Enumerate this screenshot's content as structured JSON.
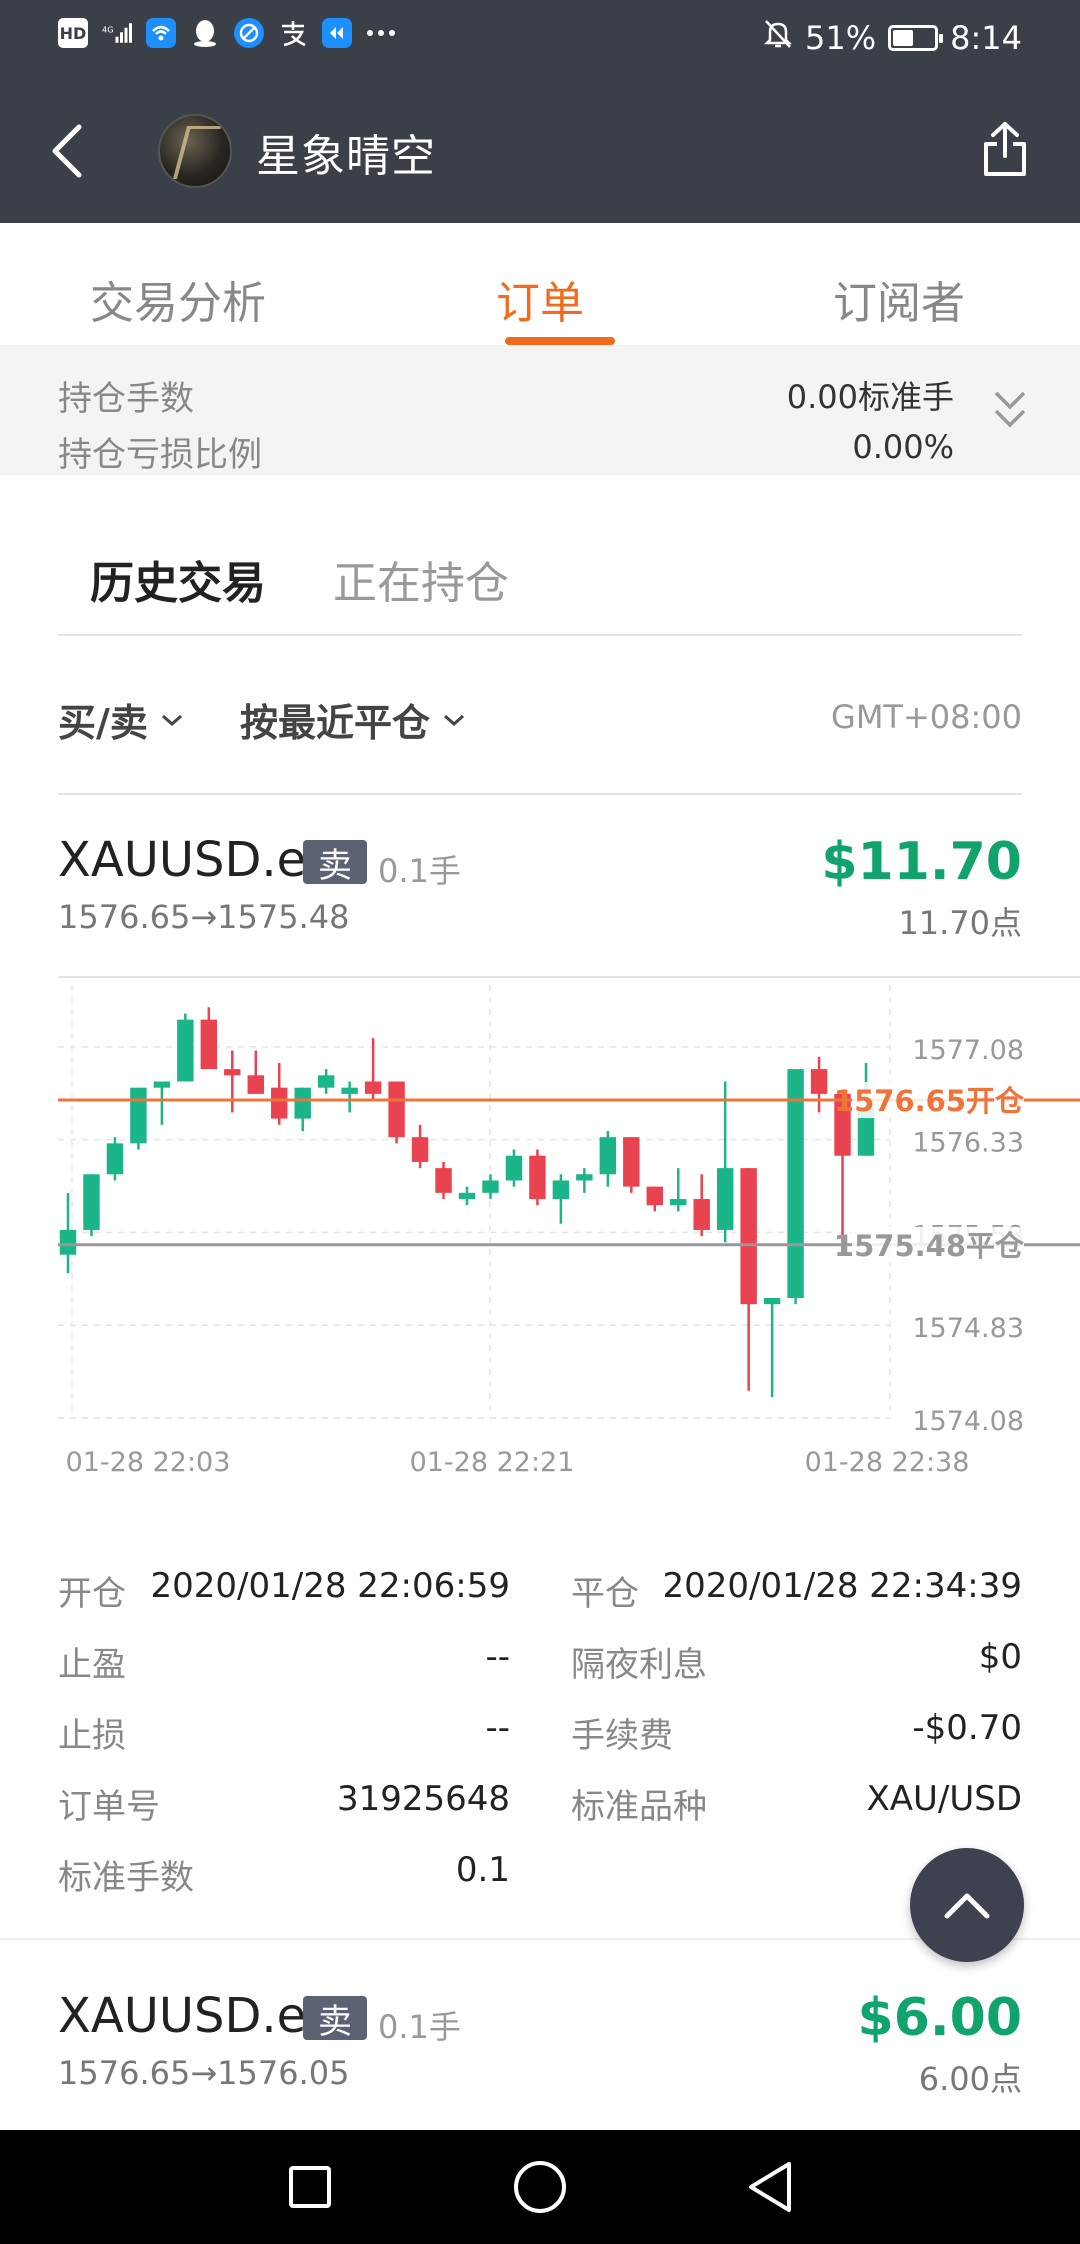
{
  "status_bar": {
    "left_icons": [
      "hd-icon",
      "signal-4g-icon",
      "wifi-icon",
      "qq-icon",
      "browser-icon",
      "alipay-icon",
      "app-icon",
      "more-dots-icon"
    ],
    "battery_level": 0.51,
    "battery_text": "51%",
    "time": "8:14"
  },
  "header": {
    "title": "星象晴空"
  },
  "tabs": [
    {
      "label": "交易分析",
      "active": false
    },
    {
      "label": "订单",
      "active": true
    },
    {
      "label": "订阅者",
      "active": false
    }
  ],
  "summary": {
    "rows": [
      {
        "label": "持仓手数",
        "value": "0.00标准手"
      },
      {
        "label": "持仓亏损比例",
        "value": "0.00%"
      }
    ]
  },
  "subtabs": [
    {
      "label": "历史交易",
      "active": true
    },
    {
      "label": "正在持仓",
      "active": false
    }
  ],
  "filters": {
    "side": "买/卖",
    "sort": "按最近平仓",
    "timezone": "GMT+08:00"
  },
  "orders": [
    {
      "symbol": "XAUUSD.e",
      "side": "卖",
      "lots": "0.1手",
      "price_path": "1576.65→1575.48",
      "profit": "$11.70",
      "points": "11.70点"
    },
    {
      "symbol": "XAUUSD.e",
      "side": "卖",
      "lots": "0.1手",
      "price_path": "1576.65→1576.05",
      "profit": "$6.00",
      "points": "6.00点"
    }
  ],
  "chart_data": {
    "type": "candlestick",
    "y_ticks": [
      "1577.08",
      "1576.33",
      "1575.58",
      "1574.83",
      "1574.08"
    ],
    "x_ticks": [
      "01-28 22:03",
      "01-28 22:21",
      "01-28 22:38"
    ],
    "ylim": [
      1574.08,
      1577.58
    ],
    "grid": true,
    "open_line": {
      "value": 1576.65,
      "label": "1576.65开仓",
      "color": "#f0743a"
    },
    "close_line": {
      "value": 1575.48,
      "label": "1575.48平仓",
      "color": "#999999"
    },
    "up_color": "#1bb58a",
    "down_color": "#e8434f",
    "candles": [
      {
        "o": 1575.4,
        "h": 1575.9,
        "l": 1575.25,
        "c": 1575.6
      },
      {
        "o": 1575.6,
        "h": 1576.05,
        "l": 1575.55,
        "c": 1576.05
      },
      {
        "o": 1576.05,
        "h": 1576.35,
        "l": 1576.0,
        "c": 1576.3
      },
      {
        "o": 1576.3,
        "h": 1576.75,
        "l": 1576.25,
        "c": 1576.75
      },
      {
        "o": 1576.75,
        "h": 1576.8,
        "l": 1576.45,
        "c": 1576.8
      },
      {
        "o": 1576.8,
        "h": 1577.35,
        "l": 1576.8,
        "c": 1577.3
      },
      {
        "o": 1577.3,
        "h": 1577.4,
        "l": 1576.95,
        "c": 1576.9
      },
      {
        "o": 1576.9,
        "h": 1577.05,
        "l": 1576.55,
        "c": 1576.85
      },
      {
        "o": 1576.85,
        "h": 1577.05,
        "l": 1576.7,
        "c": 1576.7
      },
      {
        "o": 1576.75,
        "h": 1576.95,
        "l": 1576.45,
        "c": 1576.5
      },
      {
        "o": 1576.5,
        "h": 1576.75,
        "l": 1576.4,
        "c": 1576.75
      },
      {
        "o": 1576.75,
        "h": 1576.9,
        "l": 1576.7,
        "c": 1576.85
      },
      {
        "o": 1576.7,
        "h": 1576.8,
        "l": 1576.55,
        "c": 1576.75
      },
      {
        "o": 1576.8,
        "h": 1577.15,
        "l": 1576.65,
        "c": 1576.7
      },
      {
        "o": 1576.8,
        "h": 1576.8,
        "l": 1576.3,
        "c": 1576.35
      },
      {
        "o": 1576.35,
        "h": 1576.45,
        "l": 1576.1,
        "c": 1576.15
      },
      {
        "o": 1576.1,
        "h": 1576.15,
        "l": 1575.85,
        "c": 1575.9
      },
      {
        "o": 1575.85,
        "h": 1575.95,
        "l": 1575.8,
        "c": 1575.9
      },
      {
        "o": 1575.9,
        "h": 1576.05,
        "l": 1575.85,
        "c": 1576.0
      },
      {
        "o": 1576.0,
        "h": 1576.25,
        "l": 1575.95,
        "c": 1576.2
      },
      {
        "o": 1576.2,
        "h": 1576.25,
        "l": 1575.8,
        "c": 1575.85
      },
      {
        "o": 1575.85,
        "h": 1576.05,
        "l": 1575.65,
        "c": 1576.0
      },
      {
        "o": 1576.0,
        "h": 1576.1,
        "l": 1575.9,
        "c": 1576.05
      },
      {
        "o": 1576.05,
        "h": 1576.4,
        "l": 1575.95,
        "c": 1576.35
      },
      {
        "o": 1576.35,
        "h": 1576.35,
        "l": 1575.9,
        "c": 1575.95
      },
      {
        "o": 1575.95,
        "h": 1575.95,
        "l": 1575.75,
        "c": 1575.8
      },
      {
        "o": 1575.8,
        "h": 1576.1,
        "l": 1575.75,
        "c": 1575.85
      },
      {
        "o": 1575.85,
        "h": 1576.05,
        "l": 1575.55,
        "c": 1575.6
      },
      {
        "o": 1575.6,
        "h": 1576.8,
        "l": 1575.5,
        "c": 1576.1
      },
      {
        "o": 1576.1,
        "h": 1576.1,
        "l": 1574.3,
        "c": 1575.0
      },
      {
        "o": 1575.0,
        "h": 1575.05,
        "l": 1574.25,
        "c": 1575.05
      },
      {
        "o": 1575.05,
        "h": 1576.9,
        "l": 1575.0,
        "c": 1576.9
      },
      {
        "o": 1576.9,
        "h": 1577.0,
        "l": 1576.55,
        "c": 1576.7
      },
      {
        "o": 1576.7,
        "h": 1576.7,
        "l": 1575.4,
        "c": 1576.2
      },
      {
        "o": 1576.2,
        "h": 1576.95,
        "l": 1576.2,
        "c": 1576.6
      }
    ]
  },
  "details": {
    "left": [
      {
        "label": "开仓",
        "value": "2020/01/28 22:06:59"
      },
      {
        "label": "止盈",
        "value": "--"
      },
      {
        "label": "止损",
        "value": "--"
      },
      {
        "label": "订单号",
        "value": "31925648"
      },
      {
        "label": "标准手数",
        "value": "0.1"
      }
    ],
    "right": [
      {
        "label": "平仓",
        "value": "2020/01/28 22:34:39"
      },
      {
        "label": "隔夜利息",
        "value": "$0"
      },
      {
        "label": "手续费",
        "value": "-$0.70"
      },
      {
        "label": "标准品种",
        "value": "XAU/USD"
      }
    ]
  },
  "nav_bar": {
    "buttons": [
      "recents-square-icon",
      "home-circle-icon",
      "back-triangle-icon"
    ]
  },
  "colors": {
    "header_bg": "#3b3f48",
    "accent": "#f26b1d",
    "profit_green": "#10a36b",
    "badge_bg": "#5a6274"
  }
}
